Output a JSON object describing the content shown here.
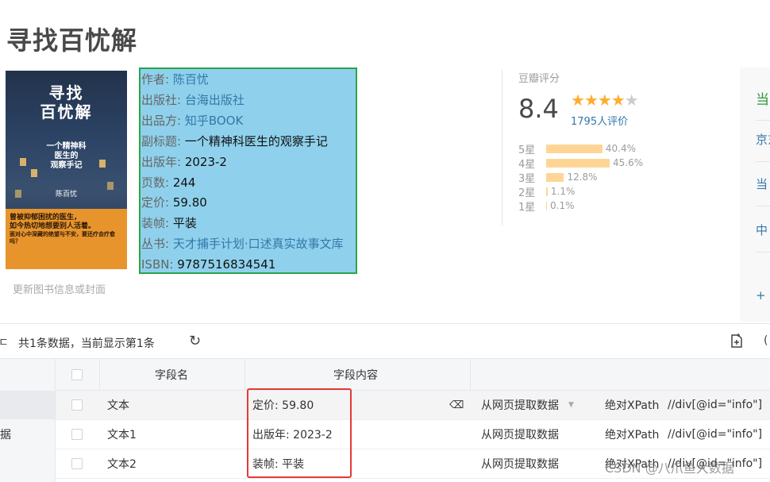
{
  "book": {
    "title": "寻找百忧解",
    "cover": {
      "title_line1": "寻找",
      "title_line2": "百忧解",
      "subtitle_line1": "一个精神科",
      "subtitle_line2": "医生的",
      "subtitle_line3": "观察手记",
      "author": "陈百忧",
      "band_line1": "曾被抑郁困扰的医生，",
      "band_line2": "如今热切地想要别人活着。",
      "band_line3": "面对心中深藏的绝望与不安，要还疗会疗愈吗？"
    },
    "update_link": "更新图书信息或封面"
  },
  "info": [
    {
      "label": "作者:",
      "value": "陈百忧",
      "link": true
    },
    {
      "label": "出版社:",
      "value": "台海出版社",
      "link": true
    },
    {
      "label": "出品方:",
      "value": "知乎BOOK",
      "link": true
    },
    {
      "label": "副标题:",
      "value": "一个精神科医生的观察手记",
      "link": false
    },
    {
      "label": "出版年:",
      "value": "2023-2",
      "link": false
    },
    {
      "label": "页数:",
      "value": "244",
      "link": false
    },
    {
      "label": "定价:",
      "value": "59.80",
      "link": false
    },
    {
      "label": "装帧:",
      "value": "平装",
      "link": false
    },
    {
      "label": "丛书:",
      "value": "天才捕手计划·口述真实故事文库",
      "link": true
    },
    {
      "label": "ISBN:",
      "value": "9787516834541",
      "link": false
    }
  ],
  "rating": {
    "label": "豆瓣评分",
    "score": "8.4",
    "stars_full": 4,
    "stars_total": 5,
    "count": "1795人评价",
    "distribution": [
      {
        "star": "5星",
        "percent": "40.4%",
        "value": 40.4
      },
      {
        "star": "4星",
        "percent": "45.6%",
        "value": 45.6
      },
      {
        "star": "3星",
        "percent": "12.8%",
        "value": 12.8
      },
      {
        "star": "2星",
        "percent": "1.1%",
        "value": 1.1
      },
      {
        "star": "1星",
        "percent": "0.1%",
        "value": 0.1
      }
    ]
  },
  "buy_panel": {
    "items": [
      "当",
      "京东",
      "当",
      "中",
      "+ 加"
    ]
  },
  "panel": {
    "toolbar": {
      "count_text": "共1条数据，当前显示第1条",
      "refresh_icon": "↻"
    },
    "left_tab": "据",
    "columns": [
      "字段名",
      "字段内容"
    ],
    "rows": [
      {
        "name": "文本",
        "content": "定价: 59.80",
        "source": "从网页提取数据",
        "path_type": "绝对XPath",
        "xpath": "//div[@id=\"info\"]"
      },
      {
        "name": "文本1",
        "content": "出版年: 2023-2",
        "source": "从网页提取数据",
        "path_type": "绝对XPath",
        "xpath": "//div[@id=\"info\"]"
      },
      {
        "name": "文本2",
        "content": "装帧: 平装",
        "source": "从网页提取数据",
        "path_type": "绝对XPath",
        "xpath": "//div[@id=\"info\"]"
      }
    ]
  },
  "watermark": "CSDN @八爪鱼大数据",
  "colors": {
    "highlight_bg": "#8fd1ec",
    "highlight_border": "#2aa44a",
    "link": "#3377aa",
    "star": "#ffac2d",
    "bar": "#ffd596",
    "red_box": "#e53935"
  }
}
